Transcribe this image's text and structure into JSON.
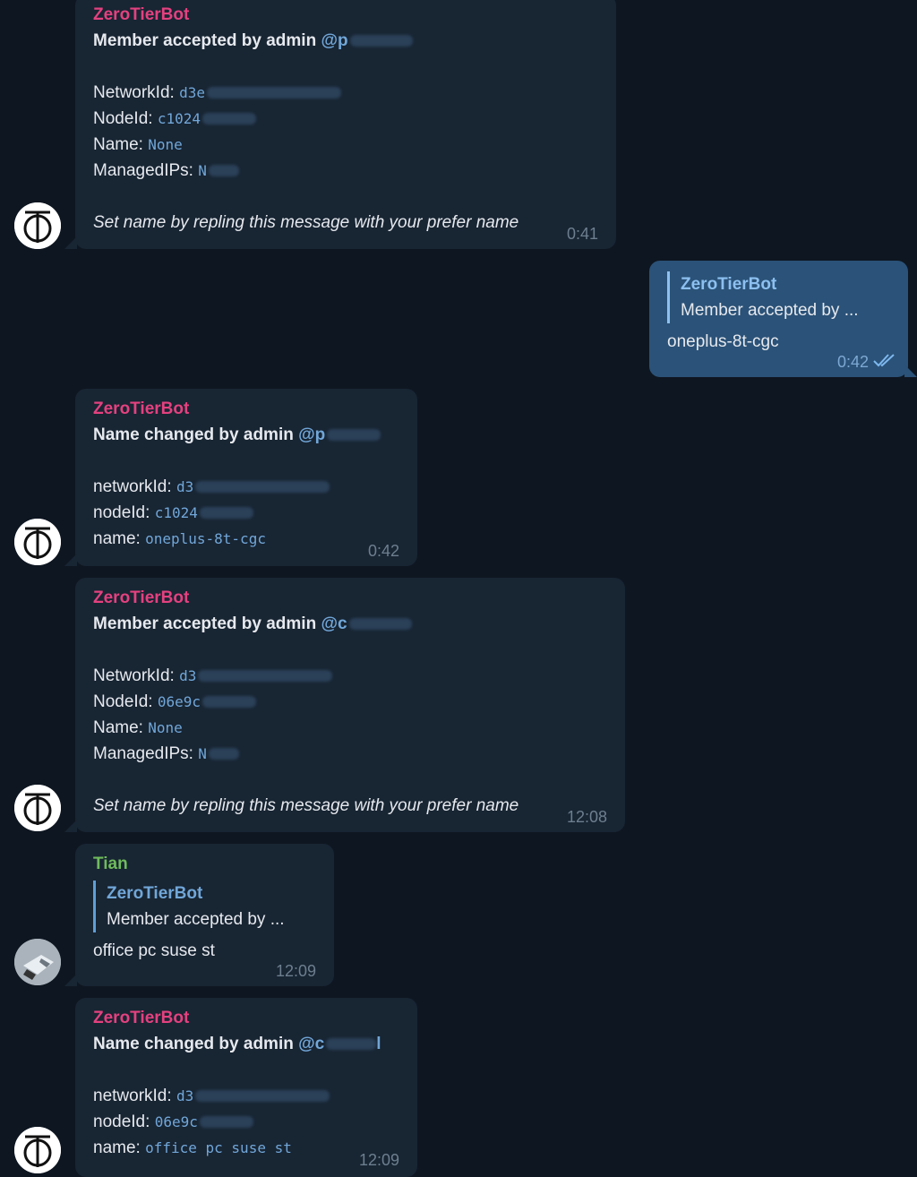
{
  "messages": [
    {
      "sender": "ZeroTierBot",
      "title": "Member accepted by admin",
      "mention": "@p",
      "l1_label": "NetworkId:",
      "l1_val": "d3e",
      "l2_label": "NodeId:",
      "l2_val": "c1024",
      "l3_label": "Name:",
      "l3_val": "None",
      "l4_label": "ManagedIPs:",
      "l4_val": "N",
      "footer": "Set name by repling this message with your prefer name",
      "time": "0:41"
    },
    {
      "reply_name": "ZeroTierBot",
      "reply_text": "Member accepted by ...",
      "text": "oneplus-8t-cgc",
      "time": "0:42"
    },
    {
      "sender": "ZeroTierBot",
      "title": "Name changed by admin",
      "mention": "@p",
      "l1_label": "networkId:",
      "l1_val": "d3",
      "l2_label": "nodeId:",
      "l2_val": "c1024",
      "l3_label": "name:",
      "l3_val": "oneplus-8t-cgc",
      "time": "0:42"
    },
    {
      "sender": "ZeroTierBot",
      "title": "Member accepted by admin",
      "mention": "@c",
      "l1_label": "NetworkId:",
      "l1_val": "d3",
      "l2_label": "NodeId:",
      "l2_val": "06e9c",
      "l3_label": "Name:",
      "l3_val": "None",
      "l4_label": "ManagedIPs:",
      "l4_val": "N",
      "footer": "Set name by repling this message with your prefer name",
      "time": "12:08"
    },
    {
      "sender": "Tian",
      "reply_name": "ZeroTierBot",
      "reply_text": "Member accepted by ...",
      "text": "office pc suse st",
      "time": "12:09"
    },
    {
      "sender": "ZeroTierBot",
      "title": "Name changed by admin",
      "mention": "@c",
      "mention_end": "l",
      "l1_label": "networkId:",
      "l1_val": "d3",
      "l2_label": "nodeId:",
      "l2_val": "06e9c",
      "l3_label": "name:",
      "l3_val": "office pc suse st",
      "time": "12:09"
    }
  ]
}
